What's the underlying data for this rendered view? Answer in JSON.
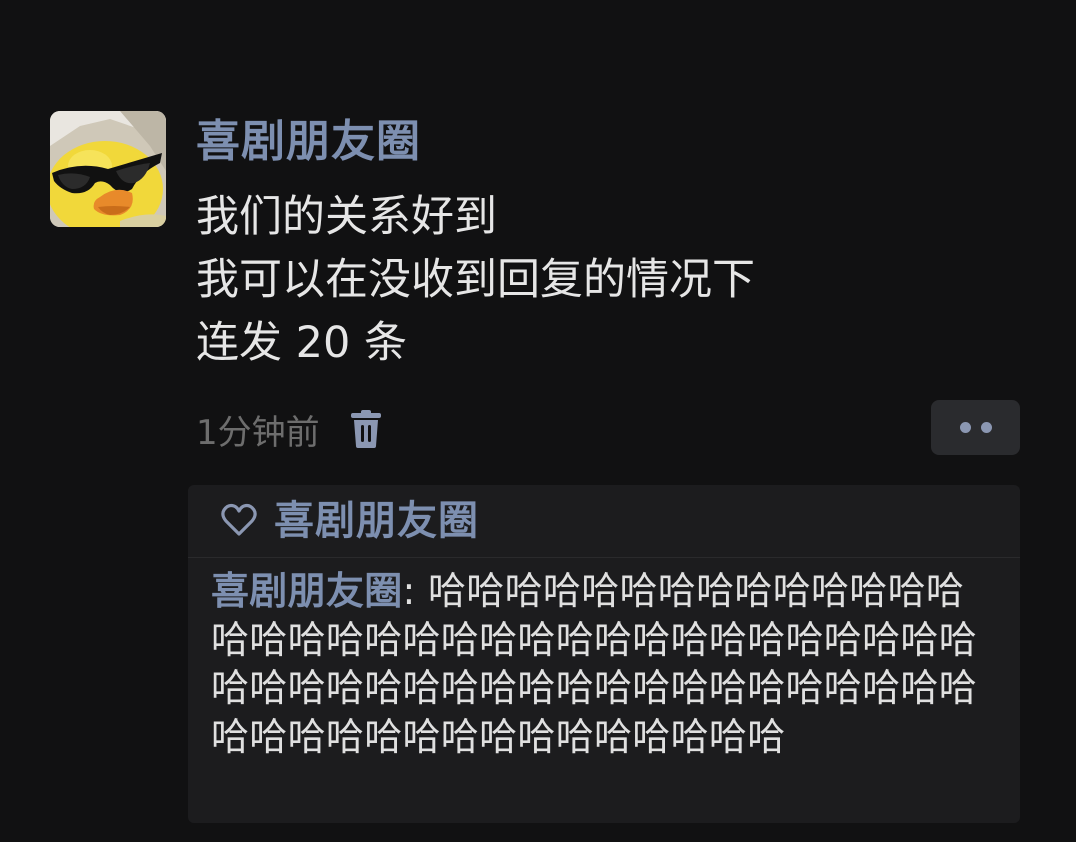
{
  "post": {
    "author": "喜剧朋友圈",
    "content_lines": [
      "我们的关系好到",
      "我可以在没收到回复的情况下",
      "连发 20 条"
    ],
    "time": "1分钟前"
  },
  "likes": {
    "names": "喜剧朋友圈"
  },
  "comment": {
    "author": "喜剧朋友圈",
    "separator": ": ",
    "text": "哈哈哈哈哈哈哈哈哈哈哈哈哈哈哈哈哈哈哈哈哈哈哈哈哈哈哈哈哈哈哈哈哈哈哈哈哈哈哈哈哈哈哈哈哈哈哈哈哈哈哈哈哈哈哈哈哈哈哈哈哈哈哈哈哈哈哈哈哈"
  },
  "icons": {
    "trash": "trash-icon",
    "more": "more-dots-icon",
    "heart": "heart-outline-icon"
  },
  "colors": {
    "background": "#111112",
    "name_blue": "#7d8fb0",
    "text": "#e6e6e6",
    "meta_gray": "#6d6d6d",
    "panel": "#1c1c1e"
  }
}
